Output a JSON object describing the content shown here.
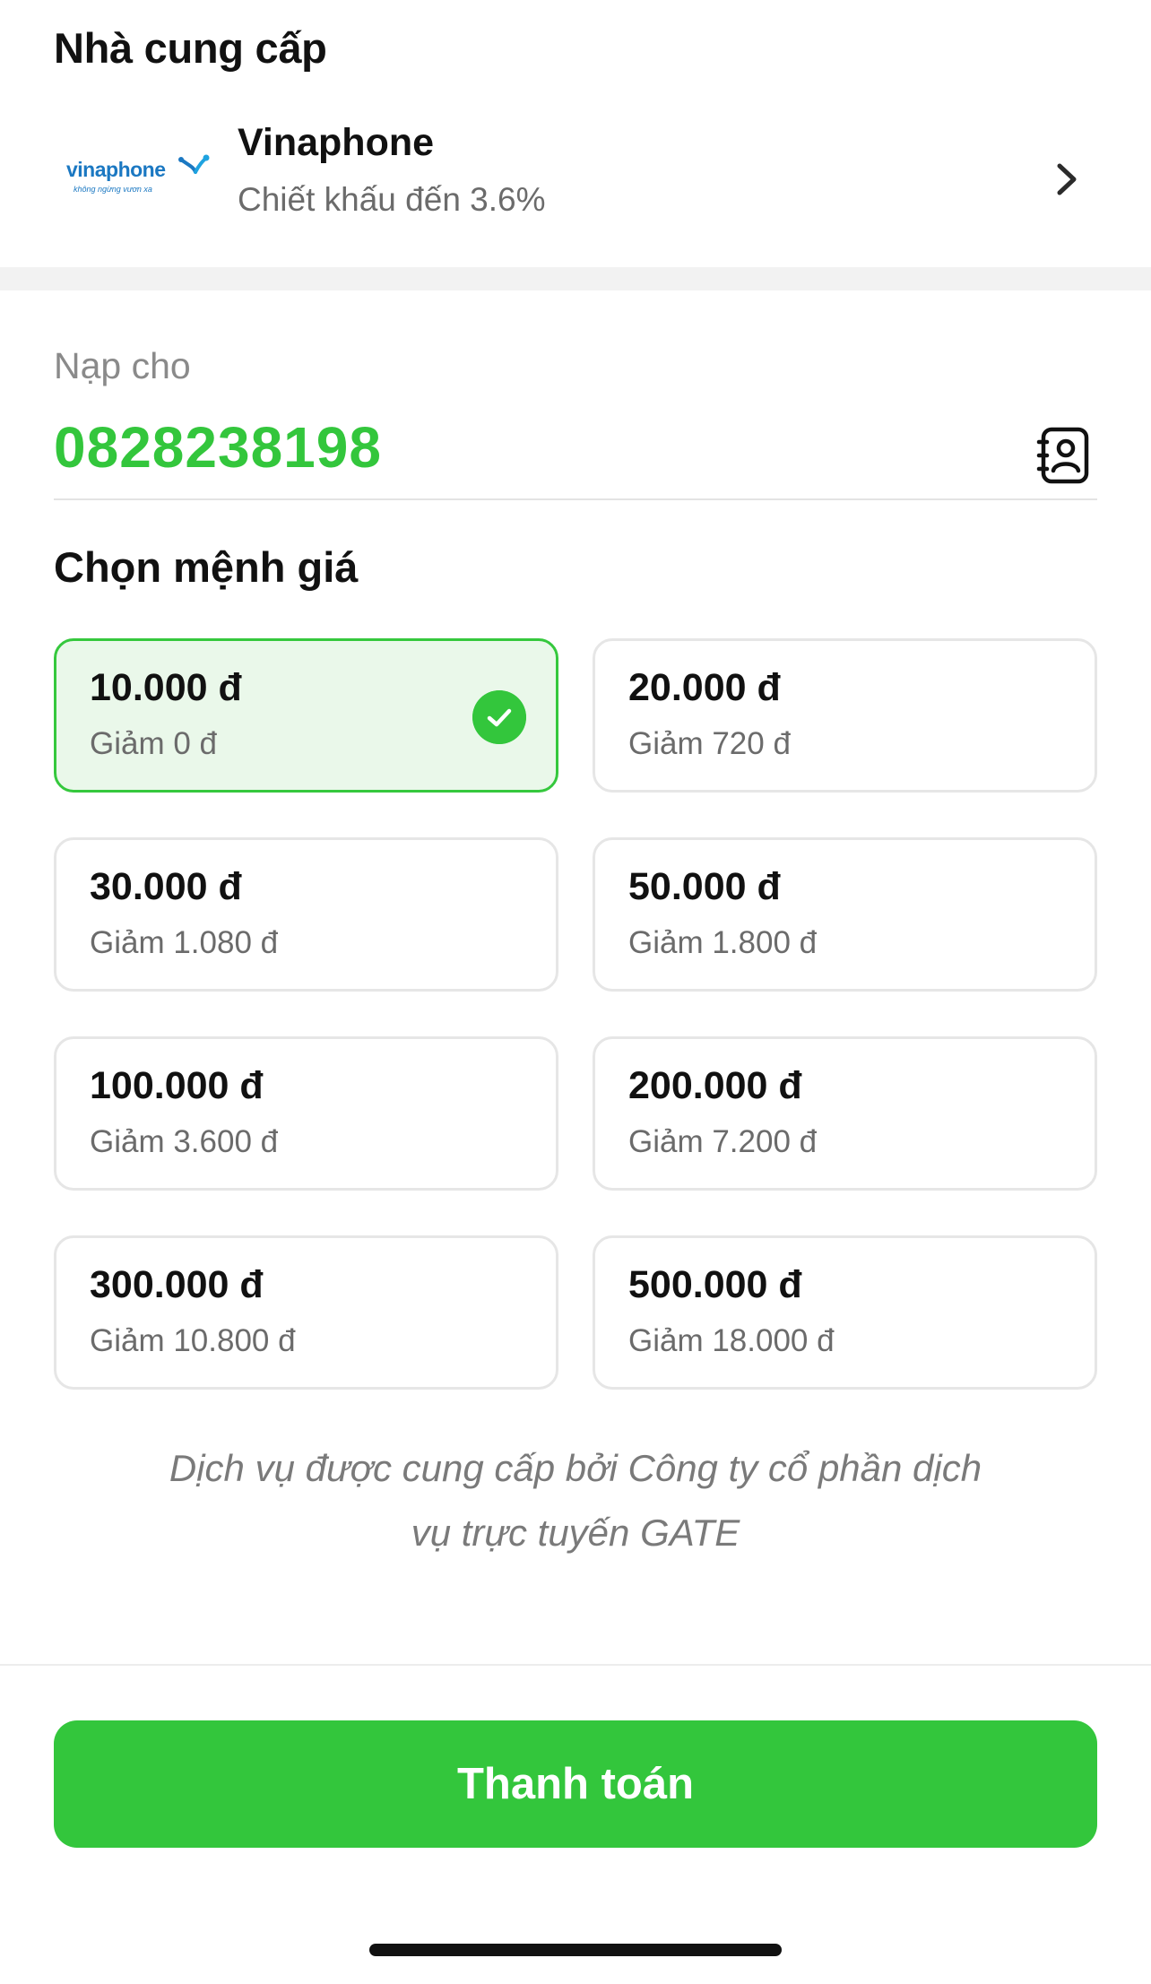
{
  "provider": {
    "section_title": "Nhà cung cấp",
    "logo_text": "vinaphone",
    "logo_tagline": "không ngừng vươn xa",
    "logo_icon": "vinaphone-logo-icon",
    "name": "Vinaphone",
    "discount": "Chiết khấu đến 3.6%",
    "chevron_icon": "chevron-right-icon"
  },
  "recipient": {
    "label": "Nạp cho",
    "phone": "0828238198",
    "contacts_icon": "contacts-book-icon"
  },
  "denominations": {
    "title": "Chọn mệnh giá",
    "items": [
      {
        "amount": "10.000 đ",
        "discount": "Giảm 0 đ",
        "selected": true
      },
      {
        "amount": "20.000 đ",
        "discount": "Giảm 720 đ",
        "selected": false
      },
      {
        "amount": "30.000 đ",
        "discount": "Giảm 1.080 đ",
        "selected": false
      },
      {
        "amount": "50.000 đ",
        "discount": "Giảm 1.800 đ",
        "selected": false
      },
      {
        "amount": "100.000 đ",
        "discount": "Giảm 3.600 đ",
        "selected": false
      },
      {
        "amount": "200.000 đ",
        "discount": "Giảm 7.200 đ",
        "selected": false
      },
      {
        "amount": "300.000 đ",
        "discount": "Giảm 10.800 đ",
        "selected": false
      },
      {
        "amount": "500.000 đ",
        "discount": "Giảm 18.000 đ",
        "selected": false
      }
    ],
    "check_icon": "check-circle-icon"
  },
  "note": {
    "line1": "Dịch vụ được cung cấp bởi Công ty cổ phần dịch",
    "line2": "vụ trực tuyến GATE"
  },
  "pay_button": {
    "label": "Thanh toán"
  },
  "colors": {
    "accent": "#33c63c",
    "selected_bg": "#eaf8ea",
    "card_border": "#e6e6e6",
    "muted_text": "#6b6b6b",
    "logo_blue": "#1b78c2"
  }
}
